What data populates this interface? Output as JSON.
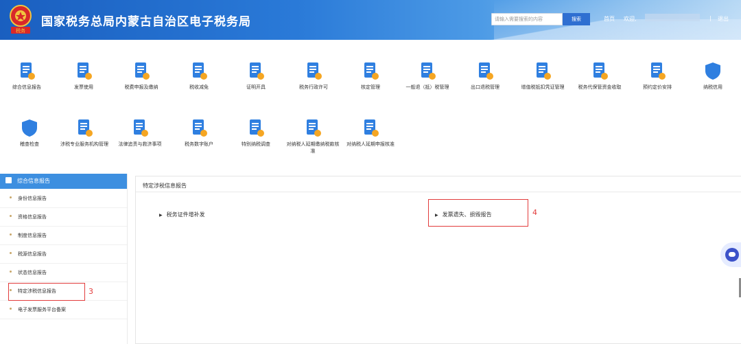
{
  "header": {
    "title": "国家税务总局内蒙古自治区电子税务局",
    "emblem_text": "税务",
    "search_placeholder": "请输入需要搜索的内容",
    "search_button": "搜索",
    "home": "首页",
    "welcome": "欢迎,",
    "separator": "|",
    "logout": "退出"
  },
  "functions": [
    {
      "label": "综合信息报告",
      "icon": "report-doc-icon"
    },
    {
      "label": "发票使用",
      "icon": "invoice-icon"
    },
    {
      "label": "税费申报及缴纳",
      "icon": "tax-payment-icon"
    },
    {
      "label": "税收减免",
      "icon": "tax-relief-icon"
    },
    {
      "label": "证明开具",
      "icon": "certificate-icon"
    },
    {
      "label": "税务行政许可",
      "icon": "admin-permit-icon"
    },
    {
      "label": "核定管理",
      "icon": "assessment-icon"
    },
    {
      "label": "一般退（抵）税管理",
      "icon": "refund-icon"
    },
    {
      "label": "出口退税管理",
      "icon": "export-refund-icon"
    },
    {
      "label": "增值税抵扣凭证管理",
      "icon": "vat-deduction-icon"
    },
    {
      "label": "税务代保管资金收取",
      "icon": "custody-fund-icon"
    },
    {
      "label": "预约定价安排",
      "icon": "pricing-arrangement-icon"
    },
    {
      "label": "纳税信用",
      "icon": "credit-shield-icon"
    },
    {
      "label": "稽查检查",
      "icon": "inspection-shield-icon"
    },
    {
      "label": "涉税专业服务机构管理",
      "icon": "agency-icon"
    },
    {
      "label": "法律追责与救济事项",
      "icon": "legal-icon"
    },
    {
      "label": "税务数字账户",
      "icon": "digital-account-icon"
    },
    {
      "label": "特别纳税调查",
      "icon": "special-investigation-icon"
    },
    {
      "label": "对纳税人延期缴纳税款核准",
      "icon": "deferred-payment-icon"
    },
    {
      "label": "对纳税人延期申报核准",
      "icon": "deferred-filing-icon"
    }
  ],
  "sidebar": {
    "title": "综合信息报告",
    "items": [
      "身份信息报告",
      "资格信息报告",
      "制度信息报告",
      "税源信息报告",
      "状态信息报告",
      "特定涉税信息报告",
      "电子发票服务平台备案"
    ]
  },
  "panel": {
    "title": "特定涉税信息报告",
    "entries": [
      "税务证件增补发",
      "发票遗失、损毁报告"
    ]
  },
  "annotations": {
    "sidebar_marker": "3",
    "entry_marker": "4"
  },
  "colors": {
    "accent": "#3d8fe0",
    "header_blue": "#1a5fc0",
    "annotation_red": "#e23b3b",
    "icon_blue": "#2f7fe0",
    "icon_orange": "#f5a623"
  }
}
